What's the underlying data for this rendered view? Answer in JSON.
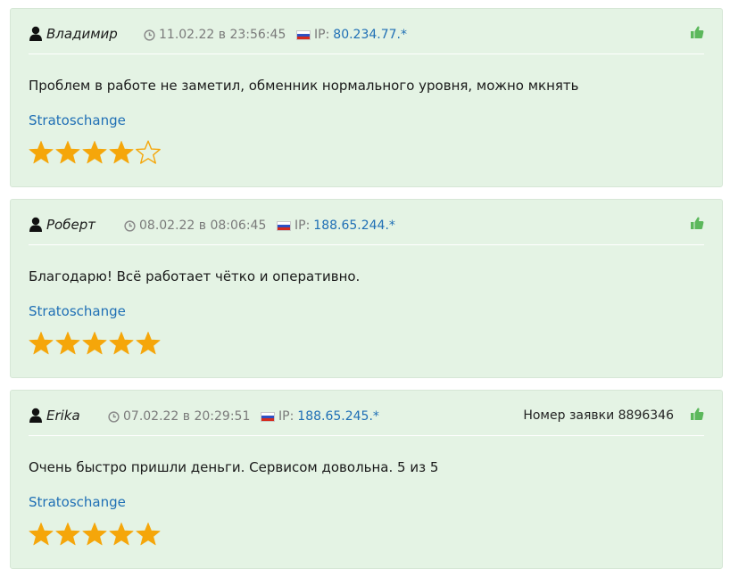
{
  "reviews": [
    {
      "author": "Владимир",
      "date": "11.02.22 в 23:56:45",
      "ip_label": "IP:",
      "ip": "80.234.77.*",
      "order": "",
      "text": "Проблем в работе не заметил, обменник нормального уровня, можно мкнять",
      "exchange": "Stratoschange",
      "rating": 4
    },
    {
      "author": "Роберт",
      "date": "08.02.22 в 08:06:45",
      "ip_label": "IP:",
      "ip": "188.65.244.*",
      "order": "",
      "text": "Благодарю! Всё работает чётко и оперативно.",
      "exchange": "Stratoschange",
      "rating": 5
    },
    {
      "author": "Erika",
      "date": "07.02.22 в 20:29:51",
      "ip_label": "IP:",
      "ip": "188.65.245.*",
      "order": "Номер заявки 8896346",
      "text": "Очень быстро пришли деньги. Сервисом довольна. 5 из 5",
      "exchange": "Stratoschange",
      "rating": 5
    }
  ],
  "max_rating": 5,
  "colors": {
    "card_bg": "#e4f3e4",
    "link": "#1f6fb5",
    "star": "#f5a60a",
    "like": "#5cb85c"
  },
  "icons": {
    "user": "user-icon",
    "clock": "clock-icon",
    "flag": "russia-flag-icon",
    "like": "thumbs-up-icon",
    "star": "star-icon"
  }
}
